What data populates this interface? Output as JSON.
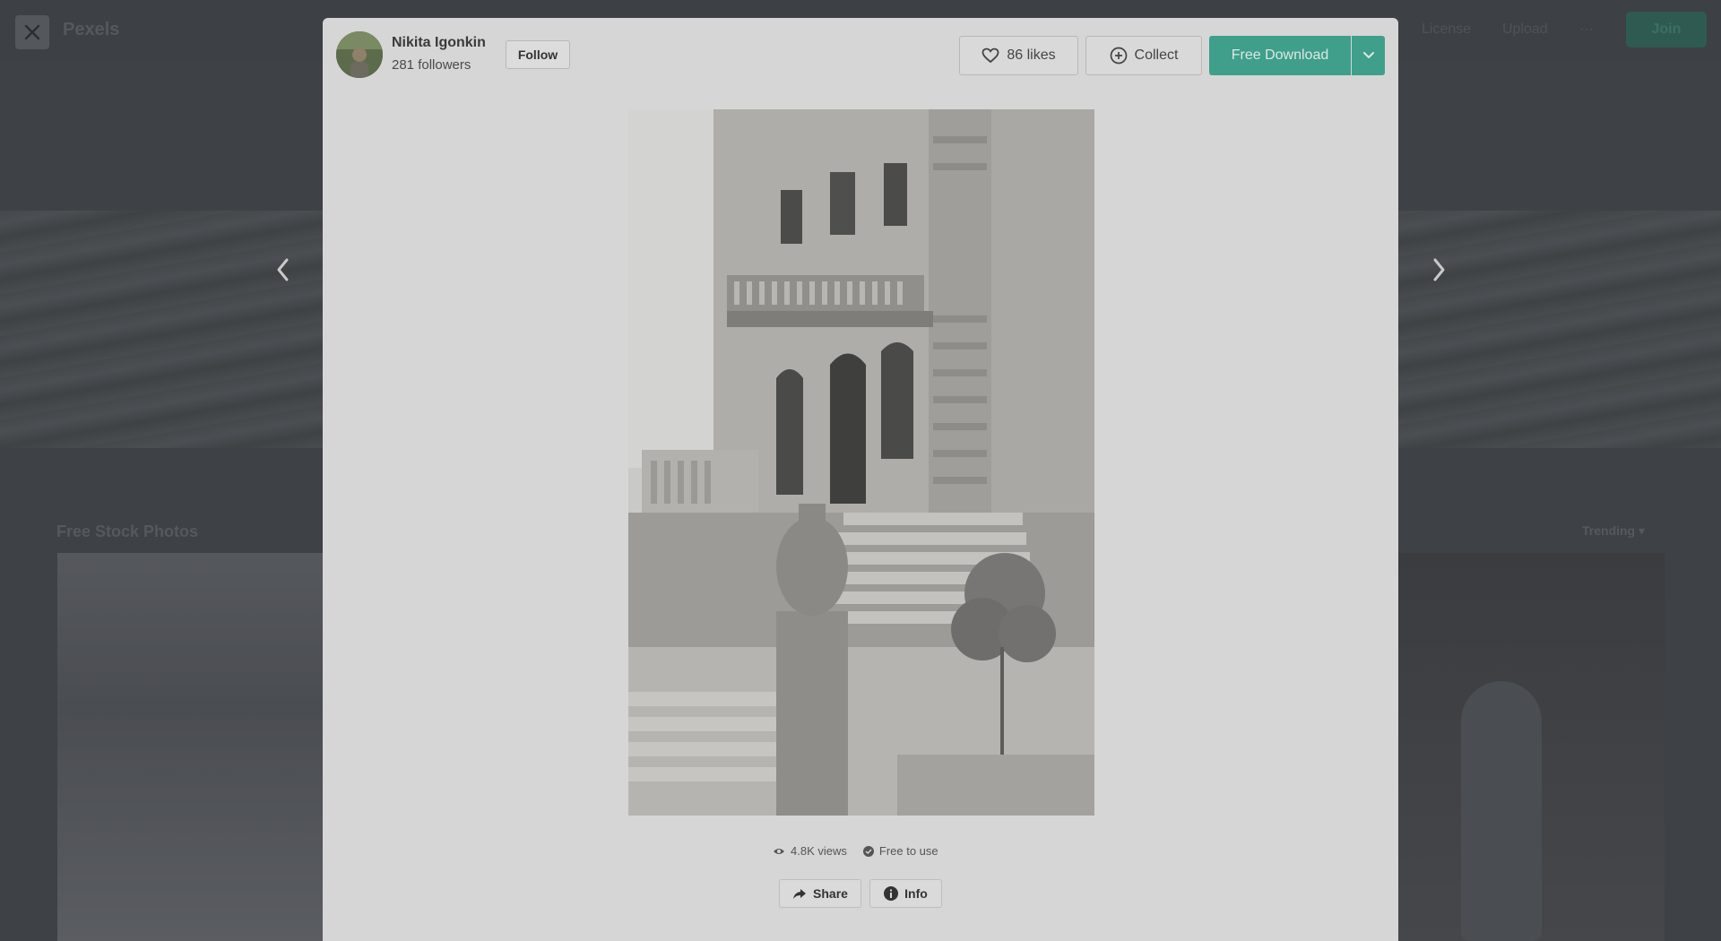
{
  "background": {
    "logo": "Pexels",
    "nav": [
      "License",
      "Upload",
      "···"
    ],
    "join_label": "Join",
    "section_title": "Free Stock Photos",
    "sort_label": "Trending"
  },
  "modal": {
    "author": {
      "name": "Nikita Igonkin",
      "followers": "281 followers",
      "follow_label": "Follow"
    },
    "actions": {
      "likes_label": "86 likes",
      "collect_label": "Collect",
      "download_label": "Free Download"
    },
    "stats": {
      "views": "4.8K views",
      "license": "Free to use"
    },
    "footer_buttons": {
      "share_label": "Share",
      "info_label": "Info"
    }
  },
  "colors": {
    "accent": "#3f9f8b",
    "overlay": "#3e4145",
    "modal_bg": "#d6d6d6"
  },
  "icons": {
    "close": "close-icon",
    "prev": "chevron-left-icon",
    "next": "chevron-right-icon",
    "heart": "heart-icon",
    "collect": "plus-circle-icon",
    "dropdown": "chevron-down-icon",
    "views": "eye-icon",
    "license": "check-circle-icon",
    "share": "share-arrow-icon",
    "info": "info-icon"
  }
}
